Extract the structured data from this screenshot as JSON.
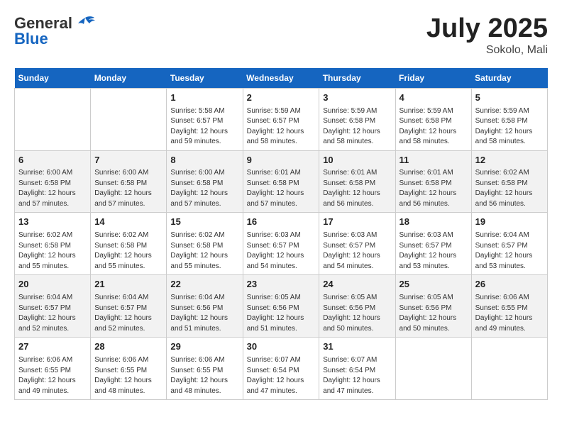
{
  "header": {
    "logo_general": "General",
    "logo_blue": "Blue",
    "month": "July 2025",
    "location": "Sokolo, Mali"
  },
  "weekdays": [
    "Sunday",
    "Monday",
    "Tuesday",
    "Wednesday",
    "Thursday",
    "Friday",
    "Saturday"
  ],
  "weeks": [
    [
      {
        "day": "",
        "sunrise": "",
        "sunset": "",
        "daylight": ""
      },
      {
        "day": "",
        "sunrise": "",
        "sunset": "",
        "daylight": ""
      },
      {
        "day": "1",
        "sunrise": "Sunrise: 5:58 AM",
        "sunset": "Sunset: 6:57 PM",
        "daylight": "Daylight: 12 hours and 59 minutes."
      },
      {
        "day": "2",
        "sunrise": "Sunrise: 5:59 AM",
        "sunset": "Sunset: 6:57 PM",
        "daylight": "Daylight: 12 hours and 58 minutes."
      },
      {
        "day": "3",
        "sunrise": "Sunrise: 5:59 AM",
        "sunset": "Sunset: 6:58 PM",
        "daylight": "Daylight: 12 hours and 58 minutes."
      },
      {
        "day": "4",
        "sunrise": "Sunrise: 5:59 AM",
        "sunset": "Sunset: 6:58 PM",
        "daylight": "Daylight: 12 hours and 58 minutes."
      },
      {
        "day": "5",
        "sunrise": "Sunrise: 5:59 AM",
        "sunset": "Sunset: 6:58 PM",
        "daylight": "Daylight: 12 hours and 58 minutes."
      }
    ],
    [
      {
        "day": "6",
        "sunrise": "Sunrise: 6:00 AM",
        "sunset": "Sunset: 6:58 PM",
        "daylight": "Daylight: 12 hours and 57 minutes."
      },
      {
        "day": "7",
        "sunrise": "Sunrise: 6:00 AM",
        "sunset": "Sunset: 6:58 PM",
        "daylight": "Daylight: 12 hours and 57 minutes."
      },
      {
        "day": "8",
        "sunrise": "Sunrise: 6:00 AM",
        "sunset": "Sunset: 6:58 PM",
        "daylight": "Daylight: 12 hours and 57 minutes."
      },
      {
        "day": "9",
        "sunrise": "Sunrise: 6:01 AM",
        "sunset": "Sunset: 6:58 PM",
        "daylight": "Daylight: 12 hours and 57 minutes."
      },
      {
        "day": "10",
        "sunrise": "Sunrise: 6:01 AM",
        "sunset": "Sunset: 6:58 PM",
        "daylight": "Daylight: 12 hours and 56 minutes."
      },
      {
        "day": "11",
        "sunrise": "Sunrise: 6:01 AM",
        "sunset": "Sunset: 6:58 PM",
        "daylight": "Daylight: 12 hours and 56 minutes."
      },
      {
        "day": "12",
        "sunrise": "Sunrise: 6:02 AM",
        "sunset": "Sunset: 6:58 PM",
        "daylight": "Daylight: 12 hours and 56 minutes."
      }
    ],
    [
      {
        "day": "13",
        "sunrise": "Sunrise: 6:02 AM",
        "sunset": "Sunset: 6:58 PM",
        "daylight": "Daylight: 12 hours and 55 minutes."
      },
      {
        "day": "14",
        "sunrise": "Sunrise: 6:02 AM",
        "sunset": "Sunset: 6:58 PM",
        "daylight": "Daylight: 12 hours and 55 minutes."
      },
      {
        "day": "15",
        "sunrise": "Sunrise: 6:02 AM",
        "sunset": "Sunset: 6:58 PM",
        "daylight": "Daylight: 12 hours and 55 minutes."
      },
      {
        "day": "16",
        "sunrise": "Sunrise: 6:03 AM",
        "sunset": "Sunset: 6:57 PM",
        "daylight": "Daylight: 12 hours and 54 minutes."
      },
      {
        "day": "17",
        "sunrise": "Sunrise: 6:03 AM",
        "sunset": "Sunset: 6:57 PM",
        "daylight": "Daylight: 12 hours and 54 minutes."
      },
      {
        "day": "18",
        "sunrise": "Sunrise: 6:03 AM",
        "sunset": "Sunset: 6:57 PM",
        "daylight": "Daylight: 12 hours and 53 minutes."
      },
      {
        "day": "19",
        "sunrise": "Sunrise: 6:04 AM",
        "sunset": "Sunset: 6:57 PM",
        "daylight": "Daylight: 12 hours and 53 minutes."
      }
    ],
    [
      {
        "day": "20",
        "sunrise": "Sunrise: 6:04 AM",
        "sunset": "Sunset: 6:57 PM",
        "daylight": "Daylight: 12 hours and 52 minutes."
      },
      {
        "day": "21",
        "sunrise": "Sunrise: 6:04 AM",
        "sunset": "Sunset: 6:57 PM",
        "daylight": "Daylight: 12 hours and 52 minutes."
      },
      {
        "day": "22",
        "sunrise": "Sunrise: 6:04 AM",
        "sunset": "Sunset: 6:56 PM",
        "daylight": "Daylight: 12 hours and 51 minutes."
      },
      {
        "day": "23",
        "sunrise": "Sunrise: 6:05 AM",
        "sunset": "Sunset: 6:56 PM",
        "daylight": "Daylight: 12 hours and 51 minutes."
      },
      {
        "day": "24",
        "sunrise": "Sunrise: 6:05 AM",
        "sunset": "Sunset: 6:56 PM",
        "daylight": "Daylight: 12 hours and 50 minutes."
      },
      {
        "day": "25",
        "sunrise": "Sunrise: 6:05 AM",
        "sunset": "Sunset: 6:56 PM",
        "daylight": "Daylight: 12 hours and 50 minutes."
      },
      {
        "day": "26",
        "sunrise": "Sunrise: 6:06 AM",
        "sunset": "Sunset: 6:55 PM",
        "daylight": "Daylight: 12 hours and 49 minutes."
      }
    ],
    [
      {
        "day": "27",
        "sunrise": "Sunrise: 6:06 AM",
        "sunset": "Sunset: 6:55 PM",
        "daylight": "Daylight: 12 hours and 49 minutes."
      },
      {
        "day": "28",
        "sunrise": "Sunrise: 6:06 AM",
        "sunset": "Sunset: 6:55 PM",
        "daylight": "Daylight: 12 hours and 48 minutes."
      },
      {
        "day": "29",
        "sunrise": "Sunrise: 6:06 AM",
        "sunset": "Sunset: 6:55 PM",
        "daylight": "Daylight: 12 hours and 48 minutes."
      },
      {
        "day": "30",
        "sunrise": "Sunrise: 6:07 AM",
        "sunset": "Sunset: 6:54 PM",
        "daylight": "Daylight: 12 hours and 47 minutes."
      },
      {
        "day": "31",
        "sunrise": "Sunrise: 6:07 AM",
        "sunset": "Sunset: 6:54 PM",
        "daylight": "Daylight: 12 hours and 47 minutes."
      },
      {
        "day": "",
        "sunrise": "",
        "sunset": "",
        "daylight": ""
      },
      {
        "day": "",
        "sunrise": "",
        "sunset": "",
        "daylight": ""
      }
    ]
  ]
}
